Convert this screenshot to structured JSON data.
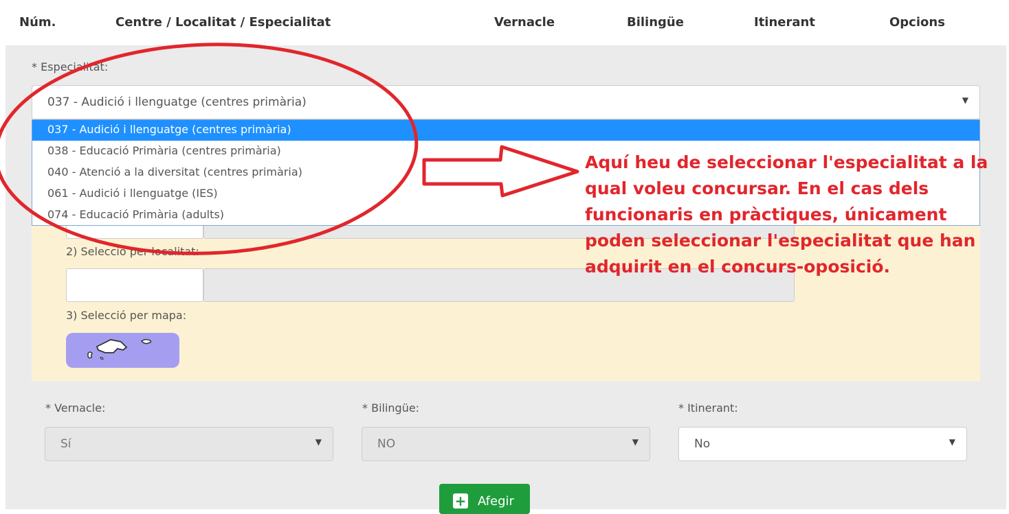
{
  "table_header": {
    "num": "Núm.",
    "centre": "Centre / Localitat / Especialitat",
    "vernacle": "Vernacle",
    "bilingue": "Bilingüe",
    "itinerant": "Itinerant",
    "opcions": "Opcions"
  },
  "especialitat": {
    "label": "* Especialitat:",
    "selected": "037 - Audició i llenguatge (centres primària)",
    "options": [
      "037 - Audició i llenguatge (centres primària)",
      "038 - Educació Primària (centres primària)",
      "040 - Atenció a la diversitat (centres primària)",
      "061 - Audició i llenguatge (IES)",
      "074 - Educació Primària (adults)"
    ]
  },
  "selection": {
    "localitat_label": "2) Selecció per localitat:",
    "mapa_label": "3) Selecció per mapa:"
  },
  "fields": {
    "vernacle_label": "* Vernacle:",
    "vernacle_value": "Sí",
    "bilingue_label": "* Bilingüe:",
    "bilingue_value": "NO",
    "itinerant_label": "* Itinerant:",
    "itinerant_value": "No"
  },
  "add_button": "Afegir",
  "annotation": "Aquí heu de seleccionar l'especialitat a la qual voleu concursar. En el cas dels funcionaris en pràctiques, únicament poden seleccionar l'especialitat que han adquirit en el concurs-oposició.",
  "colors": {
    "annotation": "#e1262c",
    "selected_option": "#1e90ff",
    "add_button": "#1f9d3d",
    "map_button": "#a59ef0"
  },
  "icons": {
    "dropdown": "caret-down-icon",
    "add": "plus-icon",
    "map": "balearic-islands-map-icon"
  }
}
